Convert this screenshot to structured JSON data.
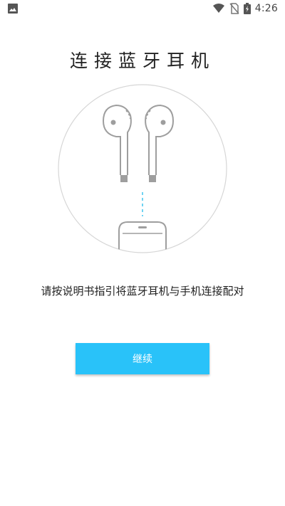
{
  "status_bar": {
    "time": "4:26",
    "icons": [
      "image-icon",
      "wifi-icon",
      "no-sim-icon",
      "battery-charging-icon"
    ]
  },
  "page": {
    "title": "连接蓝牙耳机",
    "instruction": "请按说明书指引将蓝牙耳机与手机连接配对",
    "continue_label": "继续"
  },
  "colors": {
    "accent": "#29c2f9",
    "illustration_stroke": "#9e9e9e",
    "dashed_line": "#6fd3f2"
  }
}
